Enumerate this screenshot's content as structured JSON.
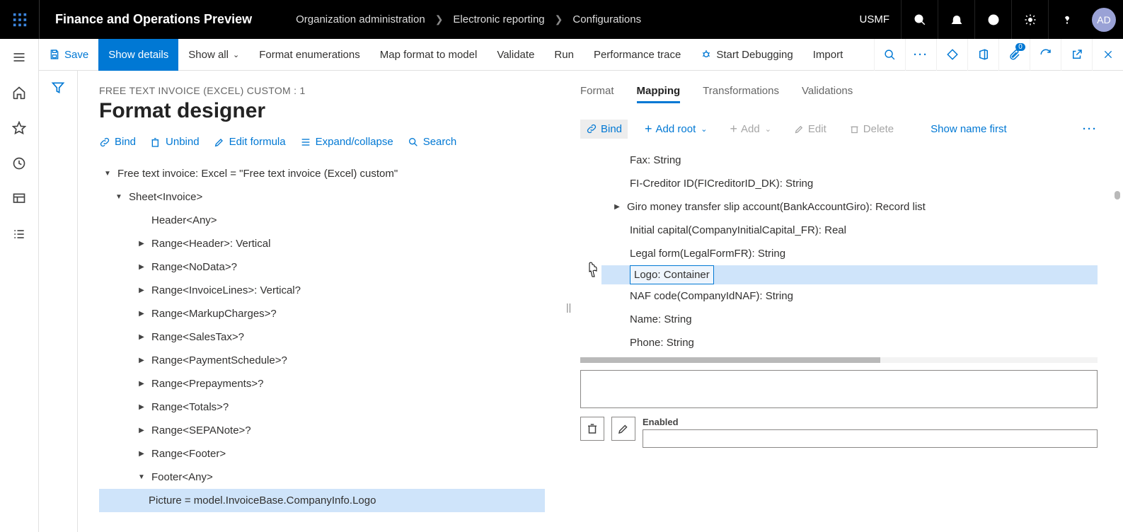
{
  "header": {
    "app_title": "Finance and Operations Preview",
    "breadcrumb": [
      "Organization administration",
      "Electronic reporting",
      "Configurations"
    ],
    "company": "USMF",
    "avatar": "AD"
  },
  "action_bar": {
    "save": "Save",
    "show_details": "Show details",
    "show_all": "Show all",
    "format_enum": "Format enumerations",
    "map_model": "Map format to model",
    "validate": "Validate",
    "run": "Run",
    "perf_trace": "Performance trace",
    "start_debug": "Start Debugging",
    "import": "Import",
    "attach_badge": "0"
  },
  "page": {
    "crumb_line": "FREE TEXT INVOICE (EXCEL) CUSTOM : 1",
    "title": "Format designer"
  },
  "left_toolbar": {
    "bind": "Bind",
    "unbind": "Unbind",
    "edit_formula": "Edit formula",
    "expand": "Expand/collapse",
    "search": "Search"
  },
  "tree": {
    "root": "Free text invoice: Excel = \"Free text invoice (Excel) custom\"",
    "sheet": "Sheet<Invoice>",
    "nodes": [
      {
        "label": "Header<Any>",
        "tri": "none"
      },
      {
        "label": "Range<Header>: Vertical",
        "tri": "right"
      },
      {
        "label": "Range<NoData>?",
        "tri": "right"
      },
      {
        "label": "Range<InvoiceLines>: Vertical?",
        "tri": "right"
      },
      {
        "label": "Range<MarkupCharges>?",
        "tri": "right"
      },
      {
        "label": "Range<SalesTax>?",
        "tri": "right"
      },
      {
        "label": "Range<PaymentSchedule>?",
        "tri": "right"
      },
      {
        "label": "Range<Prepayments>?",
        "tri": "right"
      },
      {
        "label": "Range<Totals>?",
        "tri": "right"
      },
      {
        "label": "Range<SEPANote>?",
        "tri": "right"
      },
      {
        "label": "Range<Footer>",
        "tri": "right"
      },
      {
        "label": "Footer<Any>",
        "tri": "down"
      }
    ],
    "selected": "Picture = model.InvoiceBase.CompanyInfo.Logo"
  },
  "tabs": {
    "format": "Format",
    "mapping": "Mapping",
    "transformations": "Transformations",
    "validations": "Validations"
  },
  "right_toolbar": {
    "bind": "Bind",
    "add_root": "Add root",
    "add": "Add",
    "edit": "Edit",
    "delete": "Delete",
    "show_name": "Show name first"
  },
  "sources": [
    {
      "label": "Fax: String",
      "tri": "none"
    },
    {
      "label": "FI-Creditor ID(FICreditorID_DK): String",
      "tri": "none"
    },
    {
      "label": "Giro money transfer slip account(BankAccountGiro): Record list",
      "tri": "right"
    },
    {
      "label": "Initial capital(CompanyInitialCapital_FR): Real",
      "tri": "none"
    },
    {
      "label": "Legal form(LegalFormFR): String",
      "tri": "none"
    },
    {
      "label": "Logo: Container",
      "tri": "none",
      "selected": true
    },
    {
      "label": "NAF code(CompanyIdNAF): String",
      "tri": "none"
    },
    {
      "label": "Name: String",
      "tri": "none"
    },
    {
      "label": "Phone: String",
      "tri": "none"
    }
  ],
  "bottom": {
    "enabled_label": "Enabled"
  }
}
